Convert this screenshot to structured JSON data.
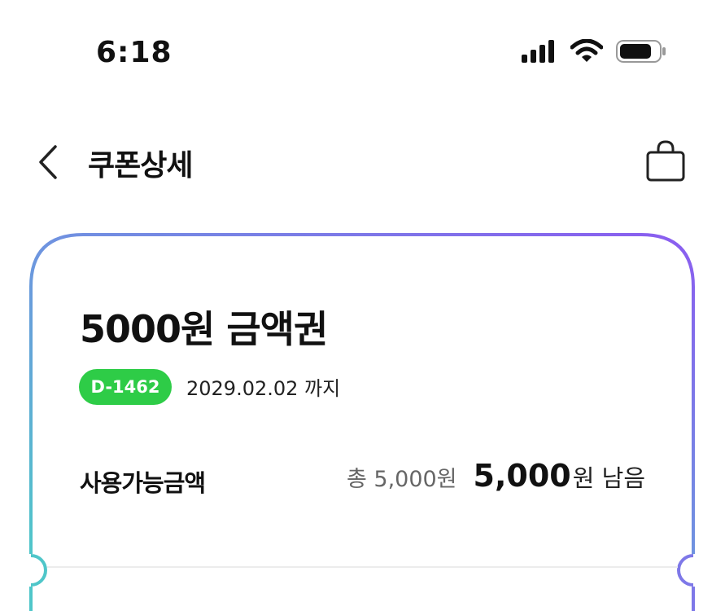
{
  "status_bar": {
    "time": "6:18"
  },
  "header": {
    "title": "쿠폰상세"
  },
  "coupon": {
    "title": "5000원 금액권",
    "dday_badge": "D-1462",
    "expiry": "2029.02.02 까지",
    "amount_label": "사용가능금액",
    "total_text": "총 5,000원",
    "remaining_value": "5,000",
    "remaining_suffix": "원 남음"
  },
  "colors": {
    "badge_green": "#2ECC47",
    "gradient_left": "#4FC6C9",
    "gradient_right": "#8B5CF0"
  },
  "icons": [
    "back-chevron-icon",
    "shopping-bag-icon",
    "signal-icon",
    "wifi-icon",
    "battery-icon"
  ]
}
